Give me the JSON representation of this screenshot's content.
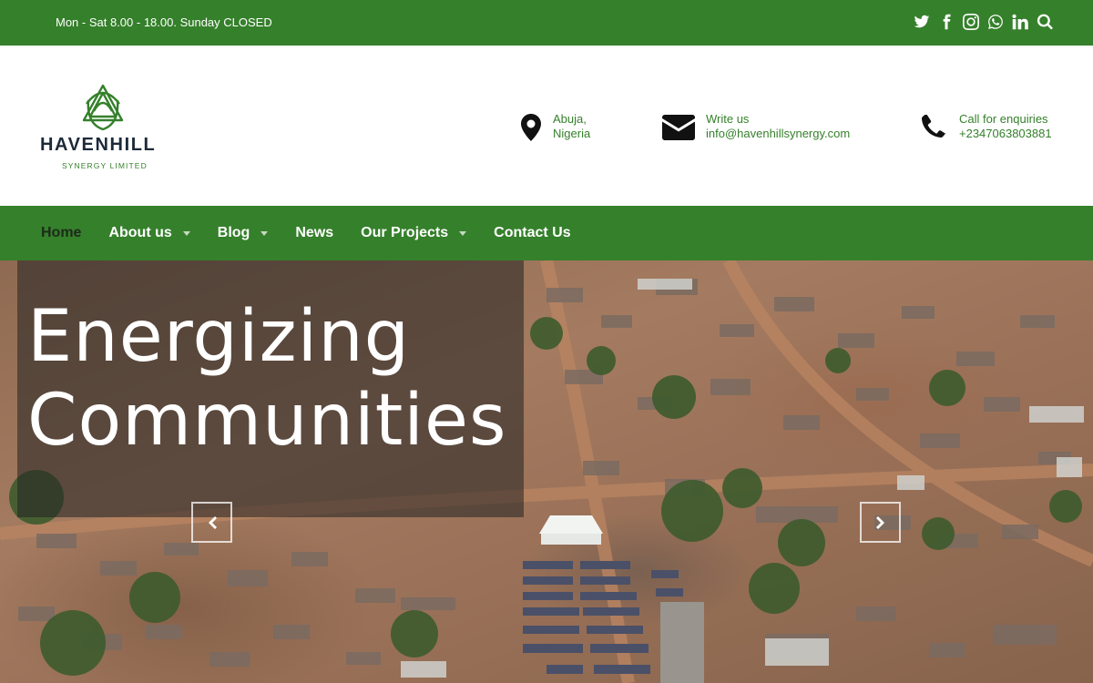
{
  "topbar": {
    "hours": "Mon - Sat 8.00 - 18.00. Sunday CLOSED",
    "social_icons": [
      "twitter-icon",
      "facebook-icon",
      "instagram-icon",
      "whatsapp-icon",
      "linkedin-icon",
      "search-icon"
    ]
  },
  "brand": {
    "name": "HAVENHILL",
    "tagline": "SYNERGY LIMITED",
    "color_primary": "#35802b"
  },
  "contacts": {
    "location": {
      "line1": "Abuja,",
      "line2": "Nigeria",
      "icon": "map-pin-icon"
    },
    "email": {
      "line1": "Write us",
      "line2": "info@havenhillsynergy.com",
      "icon": "envelope-icon"
    },
    "phone": {
      "line1": "Call for enquiries",
      "line2": "+2347063803881",
      "icon": "phone-icon"
    }
  },
  "nav": {
    "items": [
      {
        "label": "Home",
        "active": true,
        "dropdown": false
      },
      {
        "label": "About us",
        "active": false,
        "dropdown": true
      },
      {
        "label": "Blog",
        "active": false,
        "dropdown": true
      },
      {
        "label": "News",
        "active": false,
        "dropdown": false
      },
      {
        "label": "Our Projects",
        "active": false,
        "dropdown": true
      },
      {
        "label": "Contact Us",
        "active": false,
        "dropdown": false
      }
    ]
  },
  "hero": {
    "line1": "Energizing",
    "line2": "Communities",
    "prev_icon": "chevron-left-icon",
    "next_icon": "chevron-right-icon"
  }
}
